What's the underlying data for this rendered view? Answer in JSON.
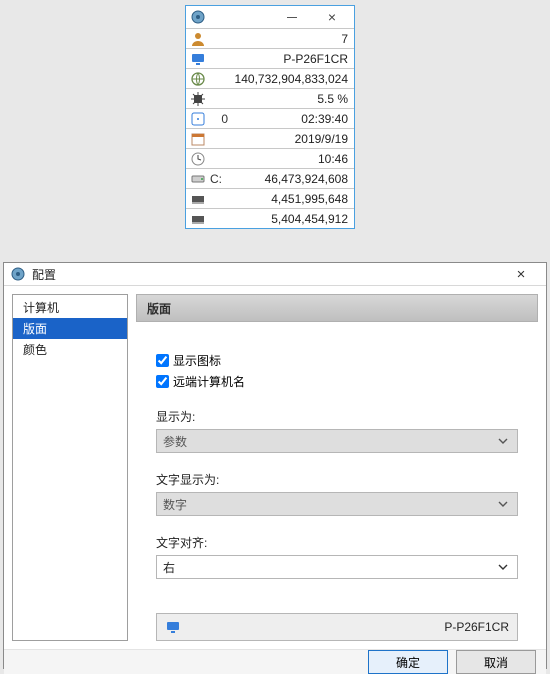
{
  "widget": {
    "rows": [
      {
        "label": "",
        "value": "7"
      },
      {
        "label": "",
        "value": "P-P26F1CR"
      },
      {
        "label": "",
        "value": "140,732,904,833,024"
      },
      {
        "label": "",
        "value": "5.5 %"
      },
      {
        "label": "0",
        "value": "02:39:40"
      },
      {
        "label": "",
        "value": "2019/9/19"
      },
      {
        "label": "",
        "value": "10:46"
      },
      {
        "label": "C:",
        "value": "46,473,924,608"
      },
      {
        "label": "",
        "value": "4,451,995,648"
      },
      {
        "label": "",
        "value": "5,404,454,912"
      }
    ]
  },
  "dialog": {
    "title": "配置",
    "close_symbol": "×",
    "tree": {
      "items": [
        "计算机",
        "版面",
        "颜色"
      ],
      "selected_index": 1
    },
    "panel": {
      "header": "版面",
      "checkbox1": {
        "label": "显示图标",
        "checked": true
      },
      "checkbox2": {
        "label": "远端计算机名",
        "checked": true
      },
      "display_as_label": "显示为:",
      "display_as_value": "参数",
      "text_display_label": "文字显示为:",
      "text_display_value": "数字",
      "text_align_label": "文字对齐:",
      "text_align_value": "右",
      "preview_value": "P-P26F1CR"
    },
    "buttons": {
      "ok": "确定",
      "cancel": "取消"
    }
  }
}
